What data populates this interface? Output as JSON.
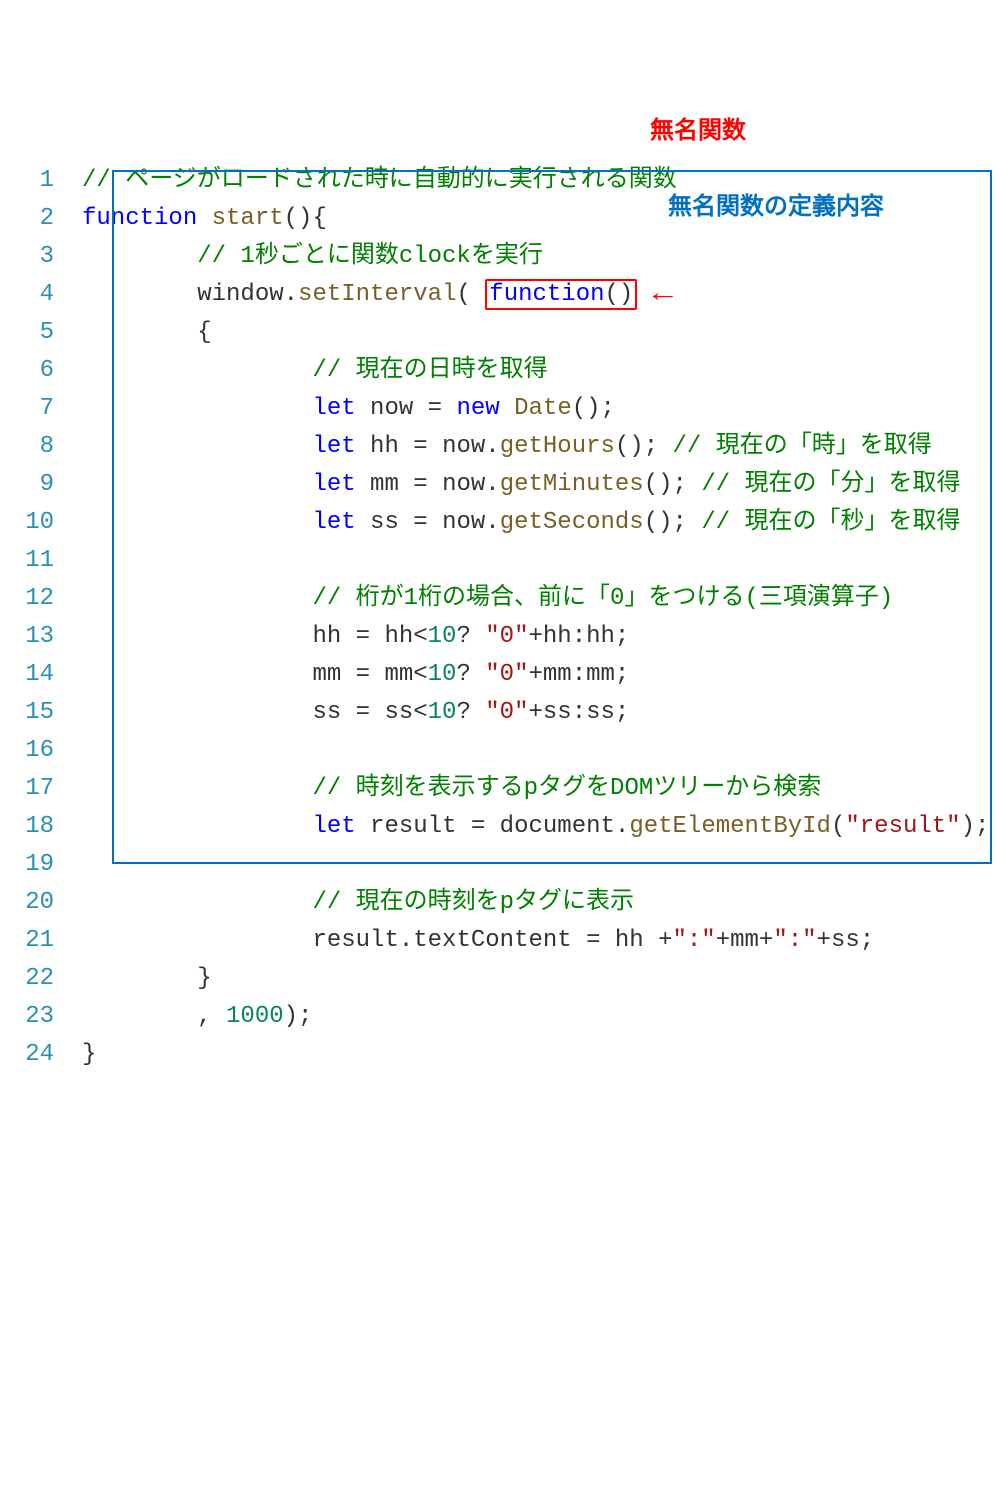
{
  "annotations": {
    "red_label": "無名関数",
    "blue_label": "無名関数の定義内容"
  },
  "lines": [
    {
      "n": 1,
      "tokens": [
        [
          "comment",
          "// ページがロードされた時に自動的に実行される関数"
        ]
      ]
    },
    {
      "n": 2,
      "tokens": [
        [
          "keyword",
          "function"
        ],
        [
          "text",
          " "
        ],
        [
          "func",
          "start"
        ],
        [
          "text",
          "(){"
        ]
      ]
    },
    {
      "n": 3,
      "indent": 8,
      "tokens": [
        [
          "comment",
          "// 1秒ごとに関数clockを実行"
        ]
      ]
    },
    {
      "n": 4,
      "indent": 8,
      "tokens": [
        [
          "text",
          "window."
        ],
        [
          "func",
          "setInterval"
        ],
        [
          "text",
          "("
        ],
        [
          "text",
          " "
        ],
        [
          "redbox_start",
          ""
        ],
        [
          "keyword",
          "function"
        ],
        [
          "text",
          "()"
        ],
        [
          "redbox_end",
          ""
        ],
        [
          "arrow",
          ""
        ]
      ]
    },
    {
      "n": 5,
      "indent": 8,
      "tokens": [
        [
          "text",
          "{"
        ]
      ]
    },
    {
      "n": 6,
      "indent": 16,
      "tokens": [
        [
          "comment",
          "// 現在の日時を取得"
        ]
      ]
    },
    {
      "n": 7,
      "indent": 16,
      "tokens": [
        [
          "keyword",
          "let"
        ],
        [
          "text",
          " now = "
        ],
        [
          "keyword",
          "new"
        ],
        [
          "text",
          " "
        ],
        [
          "func",
          "Date"
        ],
        [
          "text",
          "();"
        ]
      ]
    },
    {
      "n": 8,
      "indent": 16,
      "tokens": [
        [
          "keyword",
          "let"
        ],
        [
          "text",
          " hh = now."
        ],
        [
          "func",
          "getHours"
        ],
        [
          "text",
          "(); "
        ],
        [
          "comment",
          "// 現在の「時」を取得"
        ]
      ]
    },
    {
      "n": 9,
      "indent": 16,
      "tokens": [
        [
          "keyword",
          "let"
        ],
        [
          "text",
          " mm = now."
        ],
        [
          "func",
          "getMinutes"
        ],
        [
          "text",
          "(); "
        ],
        [
          "comment",
          "// 現在の「分」を取得"
        ]
      ]
    },
    {
      "n": 10,
      "indent": 16,
      "tokens": [
        [
          "keyword",
          "let"
        ],
        [
          "text",
          " ss = now."
        ],
        [
          "func",
          "getSeconds"
        ],
        [
          "text",
          "(); "
        ],
        [
          "comment",
          "// 現在の「秒」を取得"
        ]
      ]
    },
    {
      "n": 11,
      "indent": 0,
      "tokens": []
    },
    {
      "n": 12,
      "indent": 16,
      "tokens": [
        [
          "comment",
          "// 桁が1桁の場合、前に「0」をつける(三項演算子)"
        ]
      ]
    },
    {
      "n": 13,
      "indent": 16,
      "tokens": [
        [
          "text",
          "hh = hh<"
        ],
        [
          "number",
          "10"
        ],
        [
          "text",
          "? "
        ],
        [
          "string",
          "\"0\""
        ],
        [
          "text",
          "+hh:hh;"
        ]
      ]
    },
    {
      "n": 14,
      "indent": 16,
      "tokens": [
        [
          "text",
          "mm = mm<"
        ],
        [
          "number",
          "10"
        ],
        [
          "text",
          "? "
        ],
        [
          "string",
          "\"0\""
        ],
        [
          "text",
          "+mm:mm;"
        ]
      ]
    },
    {
      "n": 15,
      "indent": 16,
      "tokens": [
        [
          "text",
          "ss = ss<"
        ],
        [
          "number",
          "10"
        ],
        [
          "text",
          "? "
        ],
        [
          "string",
          "\"0\""
        ],
        [
          "text",
          "+ss:ss;"
        ]
      ]
    },
    {
      "n": 16,
      "indent": 0,
      "tokens": []
    },
    {
      "n": 17,
      "indent": 16,
      "tokens": [
        [
          "comment",
          "// 時刻を表示するpタグをDOMツリーから検索"
        ]
      ]
    },
    {
      "n": 18,
      "indent": 16,
      "tokens": [
        [
          "keyword",
          "let"
        ],
        [
          "text",
          " result = document."
        ],
        [
          "func",
          "getElementById"
        ],
        [
          "text",
          "("
        ],
        [
          "string",
          "\"result\""
        ],
        [
          "text",
          ");"
        ]
      ]
    },
    {
      "n": 19,
      "indent": 0,
      "tokens": []
    },
    {
      "n": 20,
      "indent": 16,
      "tokens": [
        [
          "comment",
          "// 現在の時刻をpタグに表示"
        ]
      ]
    },
    {
      "n": 21,
      "indent": 16,
      "tokens": [
        [
          "text",
          "result.textContent = hh +"
        ],
        [
          "string",
          "\":\""
        ],
        [
          "text",
          "+mm+"
        ],
        [
          "string",
          "\":\""
        ],
        [
          "text",
          "+ss;"
        ]
      ]
    },
    {
      "n": 22,
      "indent": 8,
      "tokens": [
        [
          "text",
          "}"
        ]
      ]
    },
    {
      "n": 23,
      "indent": 8,
      "tokens": [
        [
          "text",
          ", "
        ],
        [
          "number",
          "1000"
        ],
        [
          "text",
          ");"
        ]
      ]
    },
    {
      "n": 24,
      "indent": 0,
      "tokens": [
        [
          "text",
          "}"
        ]
      ]
    }
  ]
}
